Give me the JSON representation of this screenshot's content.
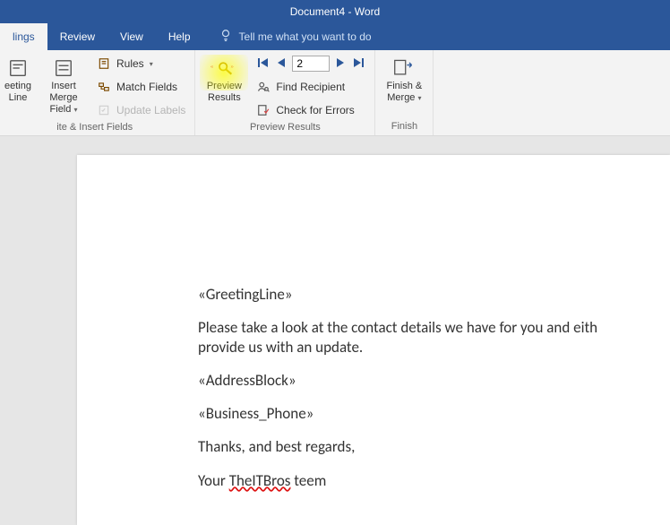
{
  "title": "Document4 - Word",
  "tabs": {
    "mailings": "lings",
    "review": "Review",
    "view": "View",
    "help": "Help"
  },
  "tellme": "Tell me what you want to do",
  "ribbon": {
    "greeting": {
      "line1": "eeting",
      "line2": "Line"
    },
    "insertMerge": {
      "line1": "Insert Merge",
      "line2": "Field"
    },
    "rules": "Rules",
    "matchFields": "Match Fields",
    "updateLabels": "Update Labels",
    "group1": "ite & Insert Fields",
    "preview": {
      "line1": "Preview",
      "line2": "Results"
    },
    "findRecipient": "Find Recipient",
    "checkErrors": "Check for Errors",
    "record": "2",
    "group2": "Preview Results",
    "finish": {
      "line1": "Finish &",
      "line2": "Merge"
    },
    "group3": "Finish"
  },
  "document": {
    "greetingField": "«GreetingLine»",
    "body1": "Please take a look at the contact details we have for you and eith",
    "body2": "provide us with an update.",
    "addressField": "«AddressBlock»",
    "phoneField": "«Business_Phone»",
    "thanks": "Thanks, and best regards,",
    "sign_pre": "Your ",
    "sign_brand": "TheITBros",
    "sign_post": " teem"
  }
}
